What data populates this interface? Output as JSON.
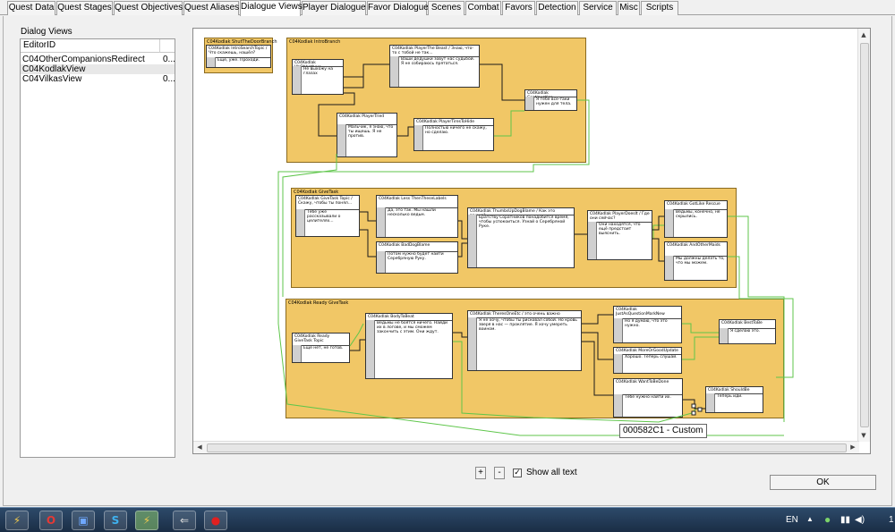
{
  "tabs": [
    "Quest Data",
    "Quest Stages",
    "Quest Objectives",
    "Quest Aliases",
    "Dialogue Views",
    "Player Dialogue",
    "Favor Dialogue",
    "Scenes",
    "Combat",
    "Favors",
    "Detection",
    "Service",
    "Misc",
    "Scripts"
  ],
  "active_tab": "Dialogue Views",
  "dialog_views": {
    "label": "Dialog Views",
    "column_header": "EditorID",
    "rows": [
      {
        "id": "C04OtherCompanionsRedirect",
        "extra": "0..."
      },
      {
        "id": "C04KodlakView",
        "extra": ""
      },
      {
        "id": "C04VilkasView",
        "extra": "0..."
      }
    ],
    "selected_index": 1
  },
  "graph": {
    "branches": [
      {
        "title": "C04Kodlak ShutTheDoorBranch"
      },
      {
        "title": "C04Kodlak IntroBranch"
      },
      {
        "title": "C04Kodlak GiveTask"
      },
      {
        "title": "C04Kodlak Ready GiveTask"
      }
    ],
    "topics": [
      {
        "head": "C04Kodlak IntroSearchTopic / Что скажешь, нашёл?",
        "body": "Ещё, уже. Проходи."
      },
      {
        "head": "C04Kodlak UhOhhathore",
        "body": "Не выхожу на глазах"
      },
      {
        "head": "C04Kodlak PlayerThe Beast / Знаю, что-то с тобой не так...",
        "body": "Ваши дедушки зовут нас судьбой. Я не собираюсь прятаться."
      },
      {
        "head": "C04Kodlak PlayerTried",
        "body": "Мальчик, я знаю, что ты ищешь. Я не против."
      },
      {
        "head": "C04Kodlak PlayerTiresToHide",
        "body": "Полностью ничего не скажу, но сделаю."
      },
      {
        "head": "C04Kodlak Continuation",
        "body": "Я тебе всё-таки нужен для тела."
      },
      {
        "head": "C04Kodlak GiveTask Topic / Скажу, чтобы ты понял...",
        "body": "Тебе уже рассказывали о целителях..."
      },
      {
        "head": "C04Kodlak Less ThenTheseLabels",
        "body": "Да, это так. Мы нашли несколько ведьм."
      },
      {
        "head": "C04Kodlak BadDogBlame",
        "body": "Потом нужно будет найти Серебряную Руку."
      },
      {
        "head": "C04Kodlak ThumbsUpDogBlame / Как это важно?",
        "body": "Братству Соратников понадобится время, чтобы успокоиться. Узнай о Серебряной Руке."
      },
      {
        "head": "C04Kodlak PlayerDoesIt / Где они сейчас?",
        "body": "Они находятся, что ещё предстоит выяснить."
      },
      {
        "head": "C04Kodlak GotLike Rescue",
        "body": "Ведьмы, конечно, не скрылись."
      },
      {
        "head": "C04Kodlak AndOtherMaids",
        "body": "Мы должны делать то, что мы можем."
      },
      {
        "head": "C04Kodlak Ready GiveTask Topic",
        "body": "Ещё нет, не готов."
      },
      {
        "head": "C04Kodlak BodyToBeat",
        "body": "Ведьмы не боятся ничего. Найди их в логове, и мы сможем закончить с этим. Они ждут."
      },
      {
        "head": "C04Kodlak TheresOneEtc / это очень важно",
        "body": "Я не хочу, чтобы ты рисковал собой. Но кровь зверя в нас — проклятие. Я хочу умереть воином."
      },
      {
        "head": "C04Kodlak JustAsQuestionMarkNew",
        "body": "Но я думаю, что это нужно."
      },
      {
        "head": "C04Kodlak MoreOrGoodUpdate",
        "body": "Хорошо. Теперь слушай."
      },
      {
        "head": "C04Kodlak WantToBeDone",
        "body": "Тебе нужно найти их."
      },
      {
        "head": "C04Kodlak BestToBe",
        "body": "Я сделаю это."
      },
      {
        "head": "C04Kodlak ShouldBe",
        "body": "Теперь иди."
      }
    ],
    "tooltip": "000582C1 - Custom"
  },
  "controls": {
    "zoom_in": "+",
    "zoom_out": "-",
    "show_all_text_label": "Show all text",
    "show_all_text_checked": true,
    "ok_label": "OK"
  },
  "taskbar": {
    "apps": [
      "bolt-icon",
      "opera-icon",
      "save-icon",
      "skype-icon",
      "bolt-icon",
      "arrow-icon",
      "record-icon"
    ],
    "language": "EN",
    "clock": "1"
  },
  "colors": {
    "branch_fill": "#f1c766",
    "link_green": "#5fc64b",
    "link_black": "#1a1a1a"
  }
}
